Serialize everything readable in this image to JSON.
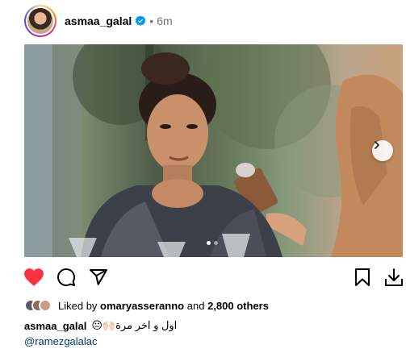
{
  "post": {
    "username": "asmaa_galal",
    "separator": "•",
    "time": "6m",
    "verified": true,
    "media": {
      "pages": 2,
      "current_page": 1
    }
  },
  "actions": {
    "like_icon": "heart-filled-icon",
    "comment_icon": "comment-icon",
    "share_icon": "send-icon",
    "save_icon": "bookmark-icon",
    "download_icon": "download-icon",
    "like_color": "#ff3040"
  },
  "likes": {
    "prefix": "Liked by",
    "user": "omaryasseranno",
    "and": "and",
    "others": "2,800 others"
  },
  "caption": {
    "username": "asmaa_galal",
    "text": "اول و اخر مرة🙌🏻😐",
    "mention": "@ramezgalalac"
  }
}
